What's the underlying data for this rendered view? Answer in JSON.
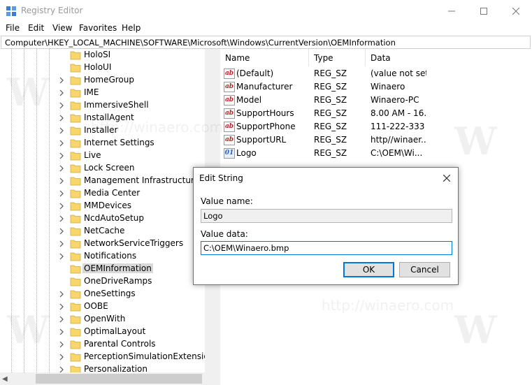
{
  "window": {
    "title": "Registry Editor",
    "controls": {
      "minimize": "—",
      "maximize": "☐",
      "close": "✕"
    }
  },
  "menu": [
    "File",
    "Edit",
    "View",
    "Favorites",
    "Help"
  ],
  "address": "Computer\\HKEY_LOCAL_MACHINE\\SOFTWARE\\Microsoft\\Windows\\CurrentVersion\\OEMInformation",
  "tree": {
    "items": [
      {
        "label": "HoloSI",
        "expandable": false
      },
      {
        "label": "HoloUI",
        "expandable": false
      },
      {
        "label": "HomeGroup",
        "expandable": true
      },
      {
        "label": "IME",
        "expandable": true
      },
      {
        "label": "ImmersiveShell",
        "expandable": true
      },
      {
        "label": "InstallAgent",
        "expandable": true
      },
      {
        "label": "Installer",
        "expandable": true
      },
      {
        "label": "Internet Settings",
        "expandable": true
      },
      {
        "label": "Live",
        "expandable": true
      },
      {
        "label": "Lock Screen",
        "expandable": true
      },
      {
        "label": "Management Infrastructure",
        "expandable": true
      },
      {
        "label": "Media Center",
        "expandable": true
      },
      {
        "label": "MMDevices",
        "expandable": true
      },
      {
        "label": "NcdAutoSetup",
        "expandable": true
      },
      {
        "label": "NetCache",
        "expandable": true
      },
      {
        "label": "NetworkServiceTriggers",
        "expandable": true
      },
      {
        "label": "Notifications",
        "expandable": true
      },
      {
        "label": "OEMInformation",
        "expandable": false,
        "selected": true
      },
      {
        "label": "OneDriveRamps",
        "expandable": false
      },
      {
        "label": "OneSettings",
        "expandable": true
      },
      {
        "label": "OOBE",
        "expandable": true
      },
      {
        "label": "OpenWith",
        "expandable": true
      },
      {
        "label": "OptimalLayout",
        "expandable": true
      },
      {
        "label": "Parental Controls",
        "expandable": true
      },
      {
        "label": "PerceptionSimulationExtensions",
        "expandable": true
      },
      {
        "label": "Personalization",
        "expandable": true
      }
    ]
  },
  "list": {
    "columns": [
      "Name",
      "Type",
      "Data"
    ],
    "rows": [
      {
        "icon": "string-value-icon",
        "name": "(Default)",
        "type": "REG_SZ",
        "data": "(value not set)"
      },
      {
        "icon": "string-value-icon",
        "name": "Manufacturer",
        "type": "REG_SZ",
        "data": "Winaero"
      },
      {
        "icon": "string-value-icon",
        "name": "Model",
        "type": "REG_SZ",
        "data": "Winaero-PC"
      },
      {
        "icon": "string-value-icon",
        "name": "SupportHours",
        "type": "REG_SZ",
        "data": "8.00 AM - 16...."
      },
      {
        "icon": "string-value-icon",
        "name": "SupportPhone",
        "type": "REG_SZ",
        "data": "111-222-333"
      },
      {
        "icon": "string-value-icon",
        "name": "SupportURL",
        "type": "REG_SZ",
        "data": "http//winaer..."
      },
      {
        "icon": "binary-value-icon",
        "name": "Logo",
        "type": "REG_SZ",
        "data": "C:\\OEM\\Wi..."
      }
    ]
  },
  "dialog": {
    "title": "Edit String",
    "value_name_label": "Value name:",
    "value_name": "Logo",
    "value_data_label": "Value data:",
    "value_data": "C:\\OEM\\Winaero.bmp",
    "ok_label": "OK",
    "cancel_label": "Cancel"
  },
  "icons": {
    "string_value_glyph": "ab",
    "binary_value_glyph": "01"
  },
  "watermark": {
    "letter": "W",
    "text": "http://winaero.com"
  },
  "colors": {
    "accent": "#0078d7",
    "folder": "#f7d66c",
    "selection": "#d9d9d9"
  }
}
